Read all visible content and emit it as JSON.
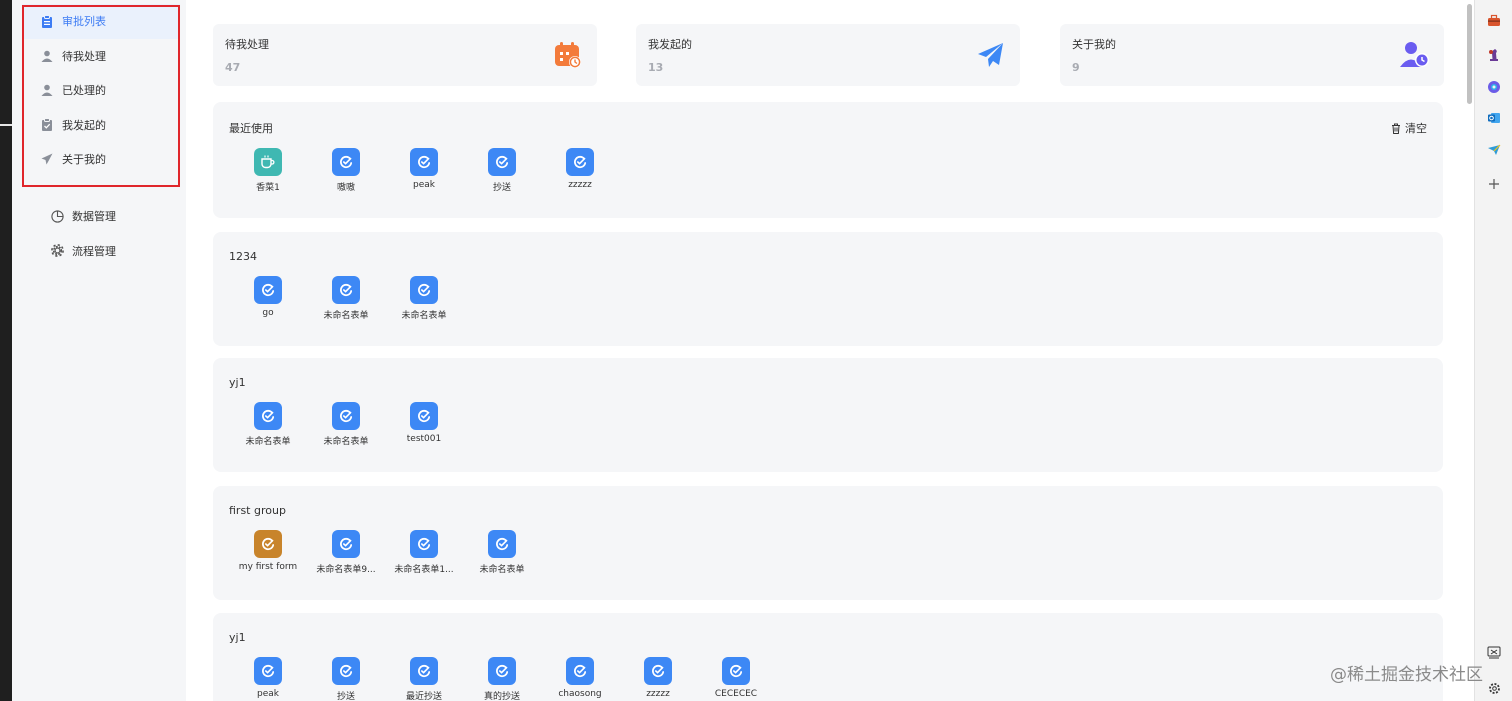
{
  "sidebar": {
    "items": [
      {
        "label": "审批列表",
        "icon": "clipboard-icon",
        "active": true
      },
      {
        "label": "待我处理",
        "icon": "user-icon"
      },
      {
        "label": "已处理的",
        "icon": "user-check-icon"
      },
      {
        "label": "我发起的",
        "icon": "clipboard-check-icon"
      },
      {
        "label": "关于我的",
        "icon": "paper-plane-icon"
      }
    ],
    "lower_items": [
      {
        "label": "数据管理",
        "icon": "pie-chart-icon"
      },
      {
        "label": "流程管理",
        "icon": "gear-icon"
      }
    ]
  },
  "stats": [
    {
      "label": "待我处理",
      "value": "47",
      "icon": "calendar-icon",
      "color": "#f37b3b"
    },
    {
      "label": "我发起的",
      "value": "13",
      "icon": "paper-plane-icon",
      "color": "#3d88f5"
    },
    {
      "label": "关于我的",
      "value": "9",
      "icon": "user-clock-icon",
      "color": "#6a5cf0"
    }
  ],
  "groups": [
    {
      "title": "最近使用",
      "clear_label": "清空",
      "apps": [
        {
          "label": "香菜1",
          "color": "#3fb8b2",
          "icon": "coffee-icon"
        },
        {
          "label": "嗷嗷",
          "color": "#3d88f5",
          "icon": "form-icon"
        },
        {
          "label": "peak",
          "color": "#3d88f5",
          "icon": "form-icon"
        },
        {
          "label": "抄送",
          "color": "#3d88f5",
          "icon": "form-icon"
        },
        {
          "label": "zzzzz",
          "color": "#3d88f5",
          "icon": "form-icon"
        }
      ]
    },
    {
      "title": "1234",
      "apps": [
        {
          "label": "go",
          "color": "#3d88f5",
          "icon": "form-icon"
        },
        {
          "label": "未命名表单",
          "color": "#3d88f5",
          "icon": "form-icon"
        },
        {
          "label": "未命名表单",
          "color": "#3d88f5",
          "icon": "form-icon"
        }
      ]
    },
    {
      "title": "yj1",
      "apps": [
        {
          "label": "未命名表单",
          "color": "#3d88f5",
          "icon": "form-icon"
        },
        {
          "label": "未命名表单",
          "color": "#3d88f5",
          "icon": "form-icon"
        },
        {
          "label": "test001",
          "color": "#3d88f5",
          "icon": "form-icon"
        }
      ]
    },
    {
      "title": "first group",
      "apps": [
        {
          "label": "my first form",
          "color": "#c8842b",
          "icon": "form-icon"
        },
        {
          "label": "未命名表单9...",
          "color": "#3d88f5",
          "icon": "form-icon"
        },
        {
          "label": "未命名表单1...",
          "color": "#3d88f5",
          "icon": "form-icon"
        },
        {
          "label": "未命名表单",
          "color": "#3d88f5",
          "icon": "form-icon"
        }
      ]
    },
    {
      "title": "yj1",
      "apps": [
        {
          "label": "peak",
          "color": "#3d88f5",
          "icon": "form-icon"
        },
        {
          "label": "抄送",
          "color": "#3d88f5",
          "icon": "form-icon"
        },
        {
          "label": "最近抄送",
          "color": "#3d88f5",
          "icon": "form-icon"
        },
        {
          "label": "真的抄送",
          "color": "#3d88f5",
          "icon": "form-icon"
        },
        {
          "label": "chaosong",
          "color": "#3d88f5",
          "icon": "form-icon"
        },
        {
          "label": "zzzzz",
          "color": "#3d88f5",
          "icon": "form-icon"
        },
        {
          "label": "CECECEC",
          "color": "#3d88f5",
          "icon": "form-icon"
        }
      ]
    }
  ],
  "extensions": [
    "toolbox-icon",
    "chess-icon",
    "copilot-icon",
    "outlook-icon",
    "plane-icon",
    "plus-icon"
  ],
  "bottom_extensions": [
    "screenshot-icon",
    "settings-icon"
  ],
  "watermark": "@稀土掘金技术社区"
}
